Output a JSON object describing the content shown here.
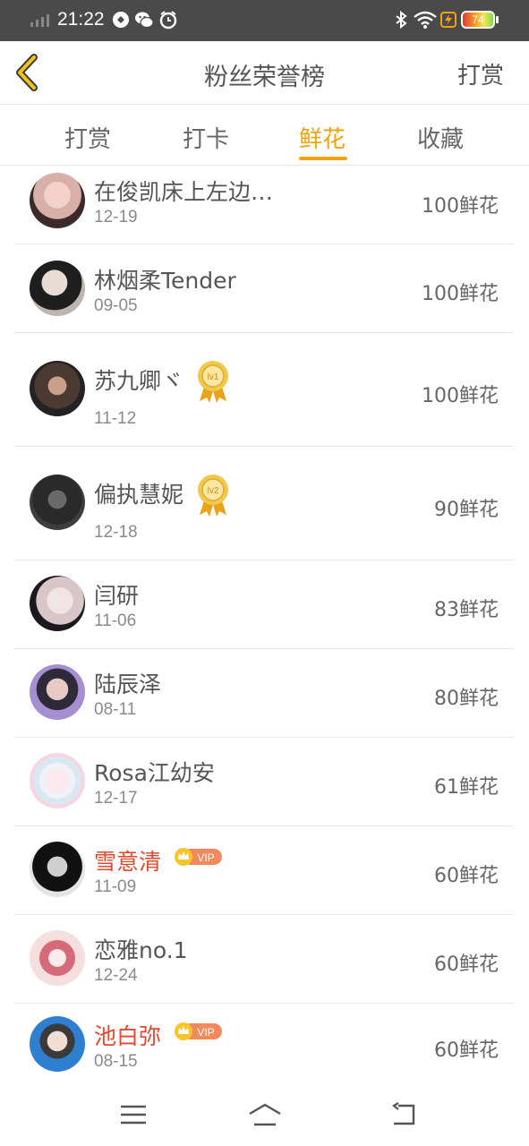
{
  "status_bar": {
    "time": "21:22",
    "battery": "74"
  },
  "header": {
    "title": "粉丝荣誉榜",
    "action": "打赏"
  },
  "tabs": [
    {
      "label": "打赏",
      "active": false
    },
    {
      "label": "打卡",
      "active": false
    },
    {
      "label": "鲜花",
      "active": true
    },
    {
      "label": "收藏",
      "active": false
    }
  ],
  "rows": [
    {
      "name": "在俊凯床上左边…",
      "date": "12-19",
      "flowers": "100鲜花"
    },
    {
      "name": "林烟柔Tender",
      "date": "09-05",
      "flowers": "100鲜花"
    },
    {
      "name": "苏九卿ヾ",
      "date": "11-12",
      "flowers": "100鲜花",
      "medal": "lv1"
    },
    {
      "name": "偏执慧妮",
      "date": "12-18",
      "flowers": "90鲜花",
      "medal": "lv2"
    },
    {
      "name": "闫研",
      "date": "11-06",
      "flowers": "83鲜花"
    },
    {
      "name": "陆辰泽",
      "date": "08-11",
      "flowers": "80鲜花"
    },
    {
      "name": "Rosa江幼安",
      "date": "12-17",
      "flowers": "61鲜花"
    },
    {
      "name": "雪意清",
      "date": "11-09",
      "flowers": "60鲜花",
      "vip": "VIP"
    },
    {
      "name": "恋雅no.1",
      "date": "12-24",
      "flowers": "60鲜花"
    },
    {
      "name": "池白弥",
      "date": "08-15",
      "flowers": "60鲜花",
      "vip": "VIP"
    }
  ],
  "colors": {
    "accent": "#f2a20c",
    "vip_name": "#e0492e",
    "status_bar": "#4a4a4a"
  }
}
